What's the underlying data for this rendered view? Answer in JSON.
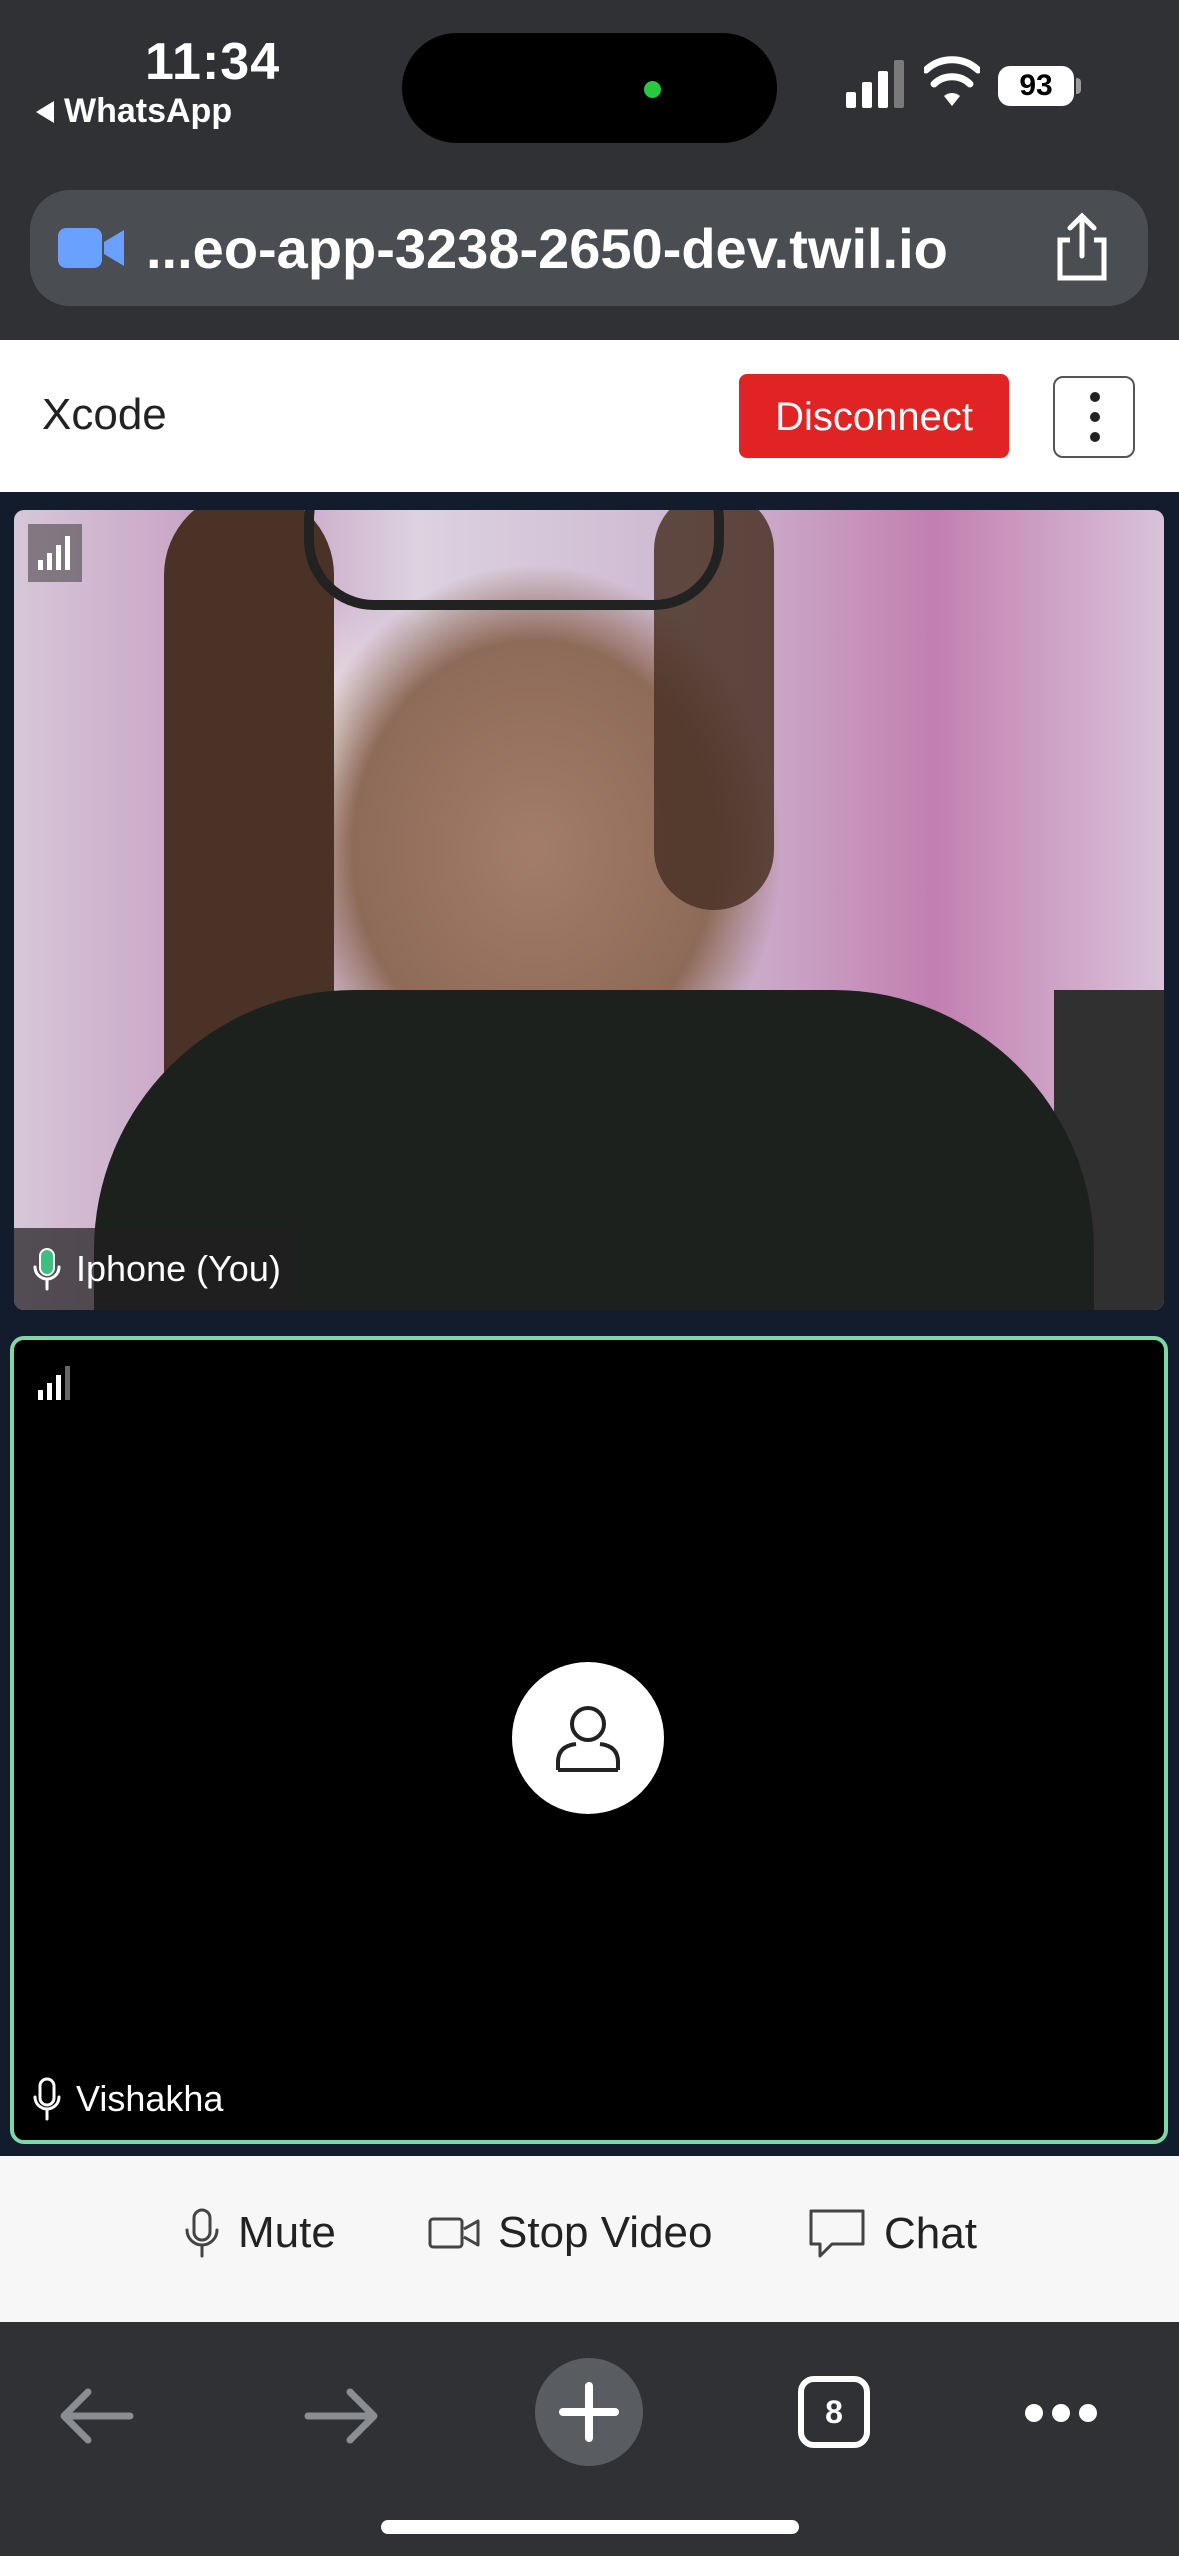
{
  "status_bar": {
    "time": "11:34",
    "back_app": "WhatsApp",
    "battery": "93"
  },
  "browser": {
    "url": "...eo-app-3238-2650-dev.twil.io",
    "tab_count": "8"
  },
  "app_header": {
    "room_name": "Xcode",
    "disconnect_label": "Disconnect"
  },
  "participants": [
    {
      "name": "Iphone (You)",
      "video": "on"
    },
    {
      "name": "Vishakha",
      "video": "off"
    }
  ],
  "controls": {
    "mute_label": "Mute",
    "stop_video_label": "Stop Video",
    "chat_label": "Chat"
  },
  "colors": {
    "disconnect": "#e02424",
    "dominant_speaker_border": "#7fd6a6",
    "mic_active": "#3fbf7f"
  }
}
